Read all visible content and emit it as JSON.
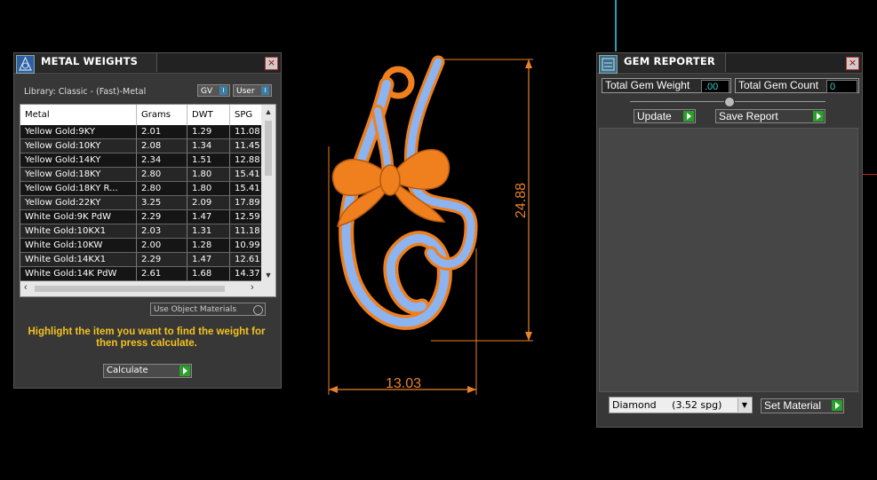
{
  "metal_panel": {
    "title": "METAL WEIGHTS",
    "library_label": "Library: Classic - (Fast)-Metal",
    "chip_gv": "GV",
    "chip_user": "User",
    "columns": [
      "Metal",
      "Grams",
      "DWT",
      "SPG"
    ],
    "rows": [
      [
        "Yellow Gold:9KY",
        "2.01",
        "1.29",
        "11.08"
      ],
      [
        "Yellow Gold:10KY",
        "2.08",
        "1.34",
        "11.45"
      ],
      [
        "Yellow Gold:14KY",
        "2.34",
        "1.51",
        "12.88"
      ],
      [
        "Yellow Gold:18KY",
        "2.80",
        "1.80",
        "15.41"
      ],
      [
        "Yellow Gold:18KY R...",
        "2.80",
        "1.80",
        "15.41"
      ],
      [
        "Yellow Gold:22KY",
        "3.25",
        "2.09",
        "17.89"
      ],
      [
        "White Gold:9K PdW",
        "2.29",
        "1.47",
        "12.59"
      ],
      [
        "White Gold:10KX1",
        "2.03",
        "1.31",
        "11.18"
      ],
      [
        "White Gold:10KW",
        "2.00",
        "1.28",
        "10.99"
      ],
      [
        "White Gold:14KX1",
        "2.29",
        "1.47",
        "12.61"
      ],
      [
        "White Gold:14K PdW",
        "2.61",
        "1.68",
        "14.37"
      ]
    ],
    "use_object_materials": "Use Object Materials",
    "instruction": "Highlight the item you want to find the weight for then press calculate.",
    "calculate_label": "Calculate"
  },
  "viewport": {
    "height_dimension": "24.88",
    "width_dimension": "13.03",
    "colors": {
      "metal": "#f07f1e",
      "gem": "#8cb4f0",
      "dimension": "#e8822a"
    }
  },
  "gem_panel": {
    "title": "GEM REPORTER",
    "total_weight_label": "Total Gem Weight",
    "total_weight_value": ".00",
    "total_count_label": "Total Gem Count",
    "total_count_value": "0",
    "update_label": "Update",
    "save_report_label": "Save Report",
    "material_select": "Diamond     (3.52 spg)",
    "set_material_label": "Set Material"
  }
}
